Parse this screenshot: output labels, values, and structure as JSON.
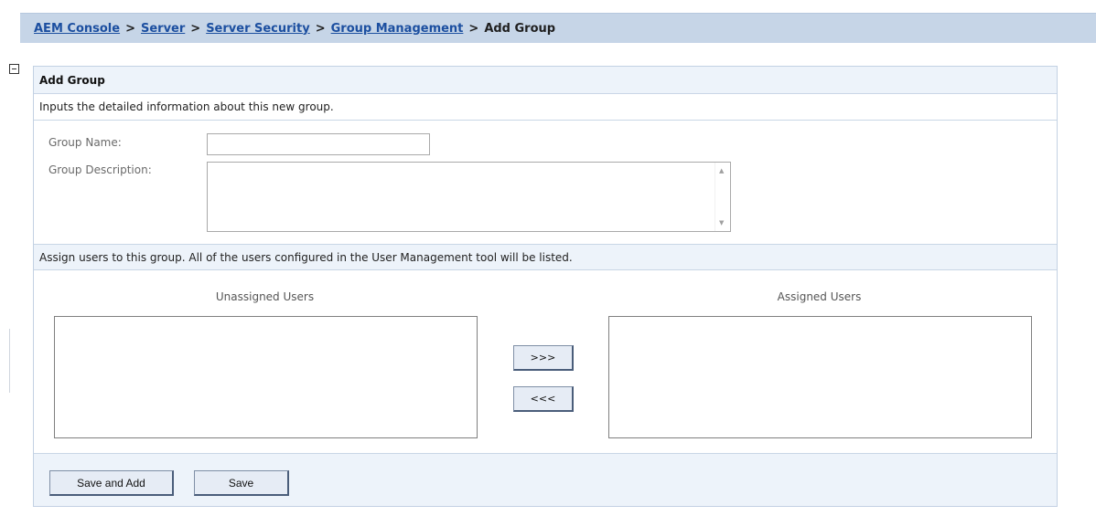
{
  "breadcrumb": {
    "items": [
      "AEM Console",
      "Server",
      "Server Security",
      "Group Management"
    ],
    "separator": ">",
    "current": "Add Group"
  },
  "panel": {
    "title": "Add Group",
    "intro": "Inputs the detailed information about this new group.",
    "group_name_label": "Group Name:",
    "group_name_value": "",
    "group_description_label": "Group Description:",
    "group_description_value": "",
    "assign_info": "Assign users to this group. All of the users configured in the User Management tool will be listed.",
    "unassigned_title": "Unassigned Users",
    "assigned_title": "Assigned Users",
    "unassigned_users": [],
    "assigned_users": [],
    "move_right_label": ">>>",
    "move_left_label": "<<<",
    "save_and_add_label": "Save and Add",
    "save_label": "Save"
  },
  "colors": {
    "breadcrumb_bg": "#c6d5e7",
    "link": "#1c4fa0",
    "panel_header_bg": "#edf3fa",
    "panel_border": "#c3d1e3"
  },
  "icons": {
    "collapse": "minus-box-icon",
    "scroll_up": "triangle-up",
    "scroll_down": "triangle-down"
  }
}
